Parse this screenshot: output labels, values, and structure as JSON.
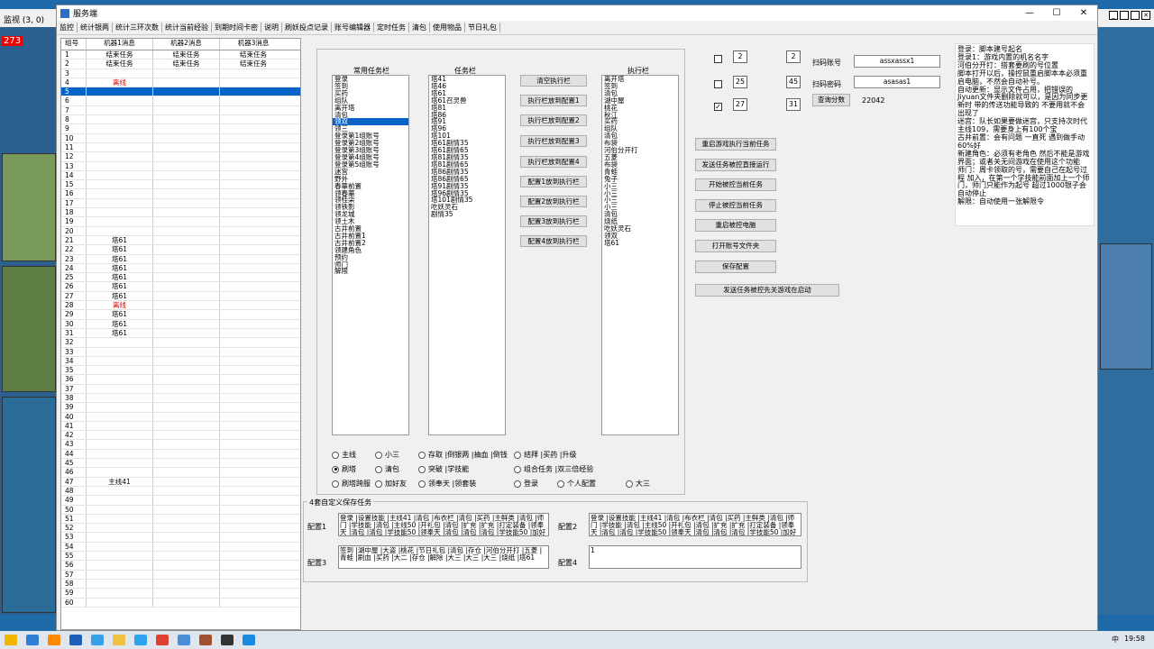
{
  "outer": {
    "title": "监视 (3, 0)",
    "counter": "273"
  },
  "window": {
    "title": "服务端",
    "min": "—",
    "max": "☐",
    "close": "✕"
  },
  "menu": [
    "监控",
    "统计银两",
    "统计三环次数",
    "统计当前经验",
    "到期时间卡密",
    "说明",
    "刷妖投点记录",
    "账号编辑器",
    "定时任务",
    "清包",
    "使用物品",
    "节日礼包"
  ],
  "grid": {
    "headers": [
      "组号",
      "机器1消息",
      "机器2消息",
      "机器3消息"
    ],
    "rows": [
      [
        "1",
        "结束任务",
        "结束任务",
        "结束任务"
      ],
      [
        "2",
        "结束任务",
        "结束任务",
        "结束任务"
      ],
      [
        "3",
        "",
        "",
        ""
      ],
      [
        "4",
        "离线",
        "",
        ""
      ],
      [
        "5",
        "",
        "",
        ""
      ],
      [
        "6",
        "",
        "",
        ""
      ],
      [
        "7",
        "",
        "",
        ""
      ],
      [
        "8",
        "",
        "",
        ""
      ],
      [
        "9",
        "",
        "",
        ""
      ],
      [
        "10",
        "",
        "",
        ""
      ],
      [
        "11",
        "",
        "",
        ""
      ],
      [
        "12",
        "",
        "",
        ""
      ],
      [
        "13",
        "",
        "",
        ""
      ],
      [
        "14",
        "",
        "",
        ""
      ],
      [
        "15",
        "",
        "",
        ""
      ],
      [
        "16",
        "",
        "",
        ""
      ],
      [
        "17",
        "",
        "",
        ""
      ],
      [
        "18",
        "",
        "",
        ""
      ],
      [
        "19",
        "",
        "",
        ""
      ],
      [
        "20",
        "",
        "",
        ""
      ],
      [
        "21",
        "塔61",
        "",
        ""
      ],
      [
        "22",
        "塔61",
        "",
        ""
      ],
      [
        "23",
        "塔61",
        "",
        ""
      ],
      [
        "24",
        "塔61",
        "",
        ""
      ],
      [
        "25",
        "塔61",
        "",
        ""
      ],
      [
        "26",
        "塔61",
        "",
        ""
      ],
      [
        "27",
        "塔61",
        "",
        ""
      ],
      [
        "28",
        "离线",
        "",
        ""
      ],
      [
        "29",
        "塔61",
        "",
        ""
      ],
      [
        "30",
        "塔61",
        "",
        ""
      ],
      [
        "31",
        "塔61",
        "",
        ""
      ],
      [
        "32",
        "",
        "",
        ""
      ],
      [
        "33",
        "",
        "",
        ""
      ],
      [
        "34",
        "",
        "",
        ""
      ],
      [
        "35",
        "",
        "",
        ""
      ],
      [
        "36",
        "",
        "",
        ""
      ],
      [
        "37",
        "",
        "",
        ""
      ],
      [
        "38",
        "",
        "",
        ""
      ],
      [
        "39",
        "",
        "",
        ""
      ],
      [
        "40",
        "",
        "",
        ""
      ],
      [
        "41",
        "",
        "",
        ""
      ],
      [
        "42",
        "",
        "",
        ""
      ],
      [
        "43",
        "",
        "",
        ""
      ],
      [
        "44",
        "",
        "",
        ""
      ],
      [
        "45",
        "",
        "",
        ""
      ],
      [
        "46",
        "",
        "",
        ""
      ],
      [
        "47",
        "主线41",
        "",
        ""
      ],
      [
        "48",
        "",
        "",
        ""
      ],
      [
        "49",
        "",
        "",
        ""
      ],
      [
        "50",
        "",
        "",
        ""
      ],
      [
        "51",
        "",
        "",
        ""
      ],
      [
        "52",
        "",
        "",
        ""
      ],
      [
        "53",
        "",
        "",
        ""
      ],
      [
        "54",
        "",
        "",
        ""
      ],
      [
        "55",
        "",
        "",
        ""
      ],
      [
        "56",
        "",
        "",
        ""
      ],
      [
        "57",
        "",
        "",
        ""
      ],
      [
        "58",
        "",
        "",
        ""
      ],
      [
        "59",
        "",
        "",
        ""
      ],
      [
        "60",
        "",
        "",
        ""
      ]
    ]
  },
  "lists": {
    "common_label": "常用任务栏",
    "common": [
      "登录",
      "签到",
      "买药",
      "组队",
      "离开塔",
      "清包",
      "领双",
      "领三",
      "登录第1组账号",
      "登录第2组账号",
      "登录第3组账号",
      "登录第4组账号",
      "登录第5组账号",
      "迷宫",
      "野外",
      "春華前置",
      "领春華",
      "领桂柒",
      "领铁影",
      "领龙城",
      "领土木",
      "古井前置",
      "古井前置1",
      "古井前置2",
      "领建角色",
      "预约",
      "师门",
      "解限"
    ],
    "task_label": "任务栏",
    "task": [
      "塔41",
      "塔46",
      "塔61",
      "塔61召灵兽",
      "塔81",
      "塔86",
      "塔91",
      "塔96",
      "塔101",
      "塔61剧情35",
      "塔61剧情65",
      "塔81剧情35",
      "塔81剧情65",
      "塔86剧情35",
      "塔86剧情65",
      "塔91剧情35",
      "塔96剧情35",
      "塔101剧情35",
      "吃妖灵石",
      "剧情35"
    ],
    "exec_label": "执行栏",
    "exec": [
      "离开塔",
      "签到",
      "清包",
      "湖中屋",
      "桃花",
      "秋江",
      "买药",
      "组队",
      "清包",
      "布袋",
      "河伯分开打",
      "五菱",
      "布袋",
      "青蛙",
      "兔子",
      "小三",
      "小三",
      "小三",
      "小三",
      "清包",
      "烧纸",
      "吃妖灵石",
      "领双",
      "塔61"
    ]
  },
  "mid_buttons": [
    "清空执行栏",
    "执行栏放到配置1",
    "执行栏放到配置2",
    "执行栏放到配置3",
    "执行栏放到配置4",
    "配置1放到执行栏",
    "配置2放到执行栏",
    "配置3放到执行栏",
    "配置4放到执行栏"
  ],
  "radios": [
    [
      "主线",
      "小三",
      "存取 |倒银两 |抽血 |倒钱",
      "结拜 |买药 |升级"
    ],
    [
      "刷塔",
      "清包",
      "突破 |学技能",
      "组合任务 |双三倍经验"
    ],
    [
      "刷塔跨服",
      "加好友",
      "领奉天 |领套装",
      "登录",
      "个人配置",
      "大三"
    ]
  ],
  "config": {
    "group_title": "4套自定义保存任务",
    "labels": [
      "配置1",
      "配置2",
      "配置3",
      "配置4"
    ],
    "values": [
      "登录 |设置技能 |主线41 |清包 |布衣栏 |清包 |买药 |主鲜类 |清包 |师门 |学技能 |清包 |主线50 |开礼包 |清包 |扩充 |扩充 |打定装备 |领奉天 |清包 |清包 |学技能50 |领奉天 |清包 |清包 |清包 |学技能50 |加好友 |加",
      "登录 |设置技能 |主线41 |清包 |布衣栏 |清包 |买药 |主鲜类 |清包 |师门 |学技能 |清包 |主线50 |开礼包 |清包 |扩充 |扩充 |打定装备 |领奉天 |清包 |清包 |学技能50 |领奉天 |清包 |清包 |清包 |学技能50 |加好友 |加",
      "签到 |湖中屋 |大盗 |桃花 |节日礼包 |清包 |存仓 |河伯分开打 |五菱 |青蛙 |刷血 |买药 |大二 |存仓 |解除 |大三 |大三 |大三 |烧纸 |塔61",
      "1"
    ]
  },
  "right": {
    "rows": [
      {
        "checked": false,
        "a": "2",
        "b": "2"
      },
      {
        "checked": false,
        "a": "25",
        "b": "45"
      },
      {
        "checked": true,
        "a": "27",
        "b": "31"
      }
    ],
    "acct_label": "扫码账号",
    "acct_value": "assxassx1",
    "pwd_label": "扫码密码",
    "pwd_value": "asasas1",
    "score_button": "查询分数",
    "score_value": "22042",
    "buttons": [
      "重启游戏执行当前任务",
      "发送任务被控直接运行",
      "开始被控当前任务",
      "停止被控当前任务",
      "重启被控电脑",
      "打开账号文件夹",
      "保存配置",
      "发送任务被控先关游戏在启动"
    ]
  },
  "notes": "登录：脚本建号起名\n登录1：游戏内置的机名名字\n河伯分开打：搭套要刷的号位置\n脚本打开以后，操控鼠重启脚本本必须重启电脑，不然会自动补号。\n自动更新：显示文件占用，把错误的Jiyuan文件夹删除就可以，是因为同步更新时 带的传送功能导致的 不要用就不会出现了\n迷宫：队长如果要做迷宫，只支持次时代主线109，需要身上有100个宝\n古井前置：会有问题 一直死 遇到做手动60%好\n新建角色：必须有老角色 然后不能是游戏界面；或者关无间游戏在使用这个功能\n师门：周卡领取的号，需要自己在起号过程 加入，在第一个学技能前面加上一个师门，师门只能作为起号 超过1000银子会自动停止\n解限：自动使用一张解限令",
  "taskbar": {
    "time": "19:58",
    "lang": "中"
  }
}
